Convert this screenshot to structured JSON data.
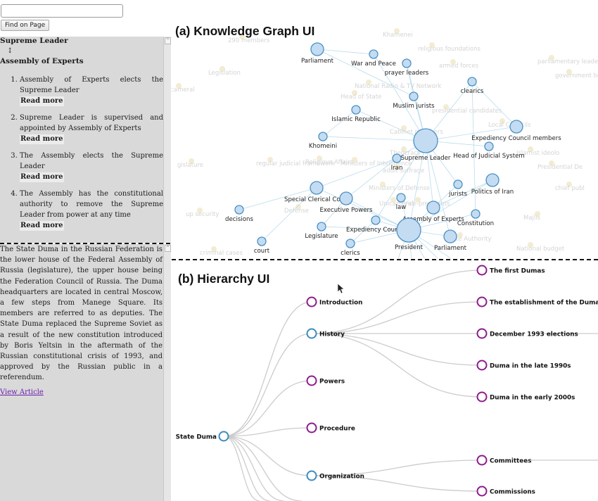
{
  "find": {
    "input_value": "",
    "placeholder": "",
    "button_label": "Find on Page"
  },
  "top_panel": {
    "title": "Supreme Leader",
    "arrow": "↕",
    "subtitle": "Assembly of Experts",
    "items": [
      {
        "text": "Assembly of Experts elects the Supreme Leader",
        "link": "Read more"
      },
      {
        "text": "Supreme Leader is supervised and appointed by Assembly of Experts",
        "link": "Read more"
      },
      {
        "text": "The Assembly elects the Supreme Leader",
        "link": "Read more"
      },
      {
        "text": "The Assembly has the constitutional authority to remove the Supreme Leader from power at any time",
        "link": "Read more"
      }
    ]
  },
  "bottom_panel": {
    "article": "The State Duma in the Russian Federation is the lower house of the Federal Assembly of Russia (legislature), the upper house being the Federation Council of Russia. The Duma headquarters are located in central Moscow, a few steps from Manege Square. Its members are referred to as deputies. The State Duma replaced the Supreme Soviet as a result of the new constitution introduced by Boris Yeltsin in the aftermath of the Russian constitutional crisis of 1993, and approved by the Russian public in a referendum.",
    "link": "View Article"
  },
  "knowledge_graph": {
    "title": "(a) Knowledge Graph UI",
    "colors": {
      "node_fill": "#c3dcf2",
      "node_stroke": "#4a90c4",
      "edge": "#b9dcec",
      "faded_label": "#d4d4d4",
      "faded_node": "#f3ecd2"
    },
    "nodes": [
      {
        "label": "Parliament",
        "size": "medium"
      },
      {
        "label": "War and Peace",
        "size": "small"
      },
      {
        "label": "prayer leaders",
        "size": "small"
      },
      {
        "label": "clearics",
        "size": "small"
      },
      {
        "label": "Muslim jurists",
        "size": "small"
      },
      {
        "label": "Islamic Republic",
        "size": "small"
      },
      {
        "label": "Expediency Council members",
        "size": "medium"
      },
      {
        "label": "Khomeini",
        "size": "small"
      },
      {
        "label": "Supreme Leader",
        "size": "large"
      },
      {
        "label": "Head of Judicial System",
        "size": "small"
      },
      {
        "label": "Iran",
        "size": "small"
      },
      {
        "label": "Special Clerical Court",
        "size": "medium"
      },
      {
        "label": "Politics of Iran",
        "size": "medium"
      },
      {
        "label": "jurists",
        "size": "small"
      },
      {
        "label": "law",
        "size": "small"
      },
      {
        "label": "Executive Powers",
        "size": "medium"
      },
      {
        "label": "Assembly of Experts",
        "size": "medium"
      },
      {
        "label": "decisions",
        "size": "small"
      },
      {
        "label": "Constitution",
        "size": "small"
      },
      {
        "label": "Legislature",
        "size": "small"
      },
      {
        "label": "Expediency Council",
        "size": "small"
      },
      {
        "label": "President",
        "size": "large"
      },
      {
        "label": "Parliament",
        "size": "medium"
      },
      {
        "label": "court",
        "size": "small"
      },
      {
        "label": "clerics",
        "size": "small"
      }
    ],
    "faded_labels": [
      "290 members",
      "Khamenei",
      "religious foundations",
      "parliamentary leaders",
      "government bra",
      "armed forces",
      "Legislation",
      "Bicameral",
      "National Radio & TV Network",
      "Head of State",
      "presidential candidates",
      "Local Councils",
      "Cabinet members",
      "Theocracy",
      "Islamist ideolo",
      "Ministers of Intelligence",
      "Presidential De",
      "adult suffrage",
      "regular judicial framework",
      "Religious Affairs",
      "gislature",
      "Ministers of Defense",
      "Unicameral",
      "Vice-presidents",
      "chief publ",
      "Defense",
      "Majlis",
      "up security",
      "State Authority",
      "National budget",
      "criminal cases"
    ]
  },
  "hierarchy": {
    "title": "(b) Hierarchy UI",
    "colors": {
      "expanded": "#3a8cbd",
      "collapsed": "#8e1a8e",
      "link": "#cccccc"
    },
    "root": {
      "label": "State Duma",
      "state": "expanded"
    },
    "children": [
      {
        "label": "Introduction",
        "state": "collapsed"
      },
      {
        "label": "History",
        "state": "expanded"
      },
      {
        "label": "Powers",
        "state": "collapsed"
      },
      {
        "label": "Procedure",
        "state": "collapsed"
      },
      {
        "label": "Organization",
        "state": "expanded"
      }
    ],
    "history_children": [
      {
        "label": "The first Dumas",
        "state": "collapsed"
      },
      {
        "label": "The establishment of the Duma",
        "state": "collapsed"
      },
      {
        "label": "December 1993 elections",
        "state": "collapsed"
      },
      {
        "label": "Duma in the late 1990s",
        "state": "collapsed"
      },
      {
        "label": "Duma in the early 2000s",
        "state": "collapsed"
      }
    ],
    "organization_children": [
      {
        "label": "Committees",
        "state": "collapsed"
      },
      {
        "label": "Commissions",
        "state": "collapsed"
      }
    ]
  }
}
